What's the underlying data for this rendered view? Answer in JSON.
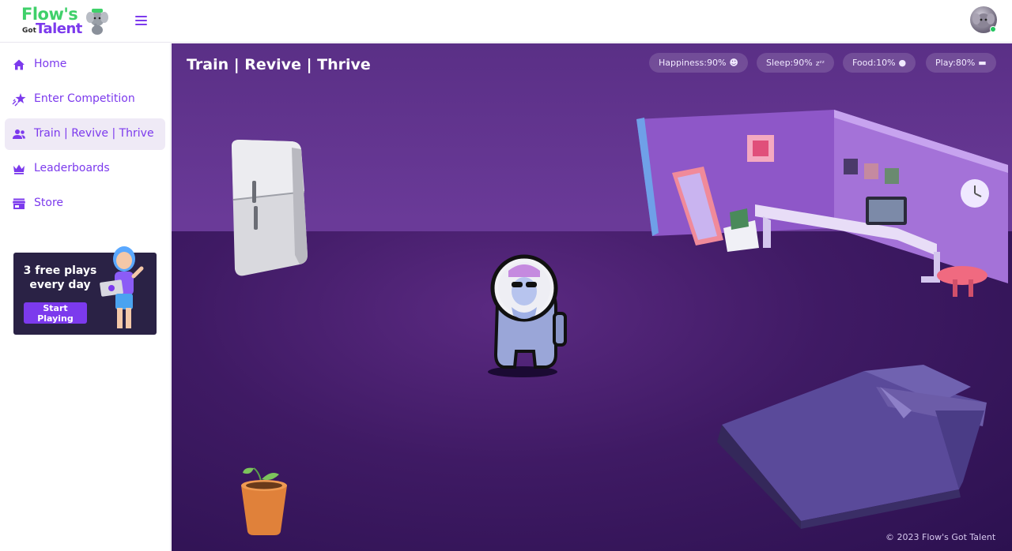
{
  "header": {
    "logo_line1": "Flow's",
    "logo_got": "Got",
    "logo_line2": "Talent",
    "menu_icon": "hamburger-menu-icon",
    "avatar_icon": "user-avatar",
    "online_status_color": "#22c55e"
  },
  "sidebar": {
    "items": [
      {
        "label": "Home",
        "icon": "home-icon",
        "active": false
      },
      {
        "label": "Enter Competition",
        "icon": "star-sparkle-icon",
        "active": false
      },
      {
        "label": "Train | Revive | Thrive",
        "icon": "people-icon",
        "active": true
      },
      {
        "label": "Leaderboards",
        "icon": "crown-icon",
        "active": false
      },
      {
        "label": "Store",
        "icon": "store-icon",
        "active": false
      }
    ],
    "promo": {
      "text": "3 free plays every day",
      "button": "Start Playing"
    }
  },
  "scene": {
    "title": "Train | Revive | Thrive",
    "stats": [
      {
        "label": "Happiness:90%",
        "icon": "smiley-icon"
      },
      {
        "label": "Sleep:90%",
        "icon": "zzz-icon"
      },
      {
        "label": "Food:10%",
        "icon": "apple-icon"
      },
      {
        "label": "Play:80%",
        "icon": "gamepad-icon"
      }
    ],
    "footer": "© 2023 Flow's Got Talent"
  },
  "colors": {
    "accent": "#7c3aed",
    "logo_green": "#3fd06a",
    "scene_wall": "#6a3a98",
    "scene_floor": "#3f1a64"
  }
}
